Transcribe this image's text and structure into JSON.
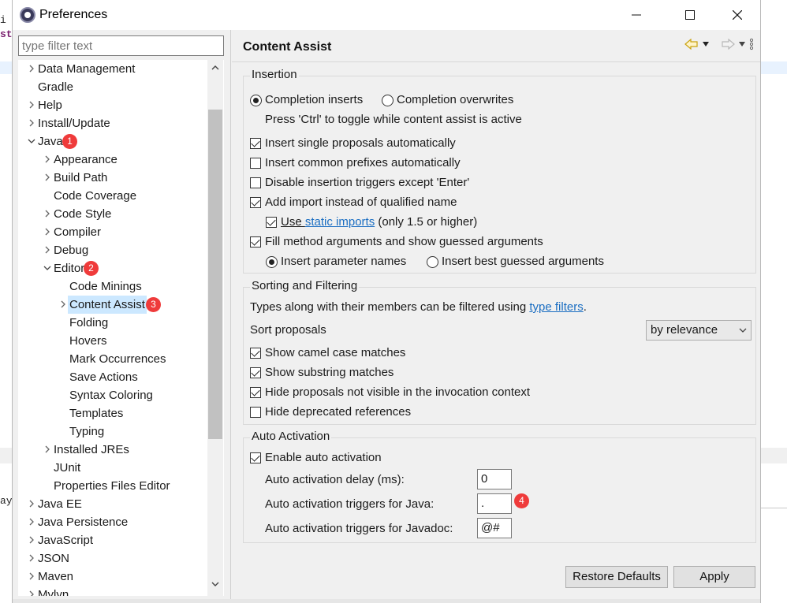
{
  "window": {
    "title": "Preferences"
  },
  "window_controls": {
    "minimize": "─",
    "maximize": "☐",
    "close": "✕"
  },
  "filter": {
    "placeholder": "type filter text"
  },
  "tree": {
    "items": [
      {
        "label": "Data Management",
        "expander": "collapsed"
      },
      {
        "label": "Gradle",
        "expander": "none"
      },
      {
        "label": "Help",
        "expander": "collapsed"
      },
      {
        "label": "Install/Update",
        "expander": "collapsed"
      },
      {
        "label": "Java",
        "expander": "expanded",
        "badge": "1"
      },
      {
        "label": "Appearance",
        "expander": "collapsed"
      },
      {
        "label": "Build Path",
        "expander": "collapsed"
      },
      {
        "label": "Code Coverage",
        "expander": "none"
      },
      {
        "label": "Code Style",
        "expander": "collapsed"
      },
      {
        "label": "Compiler",
        "expander": "collapsed"
      },
      {
        "label": "Debug",
        "expander": "collapsed"
      },
      {
        "label": "Editor",
        "expander": "expanded",
        "badge": "2"
      },
      {
        "label": "Code Minings",
        "expander": "none"
      },
      {
        "label": "Content Assist",
        "expander": "collapsed",
        "badge": "3",
        "selected": true
      },
      {
        "label": "Folding",
        "expander": "none"
      },
      {
        "label": "Hovers",
        "expander": "none"
      },
      {
        "label": "Mark Occurrences",
        "expander": "none"
      },
      {
        "label": "Save Actions",
        "expander": "none"
      },
      {
        "label": "Syntax Coloring",
        "expander": "none"
      },
      {
        "label": "Templates",
        "expander": "none"
      },
      {
        "label": "Typing",
        "expander": "none"
      },
      {
        "label": "Installed JREs",
        "expander": "collapsed"
      },
      {
        "label": "JUnit",
        "expander": "none"
      },
      {
        "label": "Properties Files Editor",
        "expander": "none"
      },
      {
        "label": "Java EE",
        "expander": "collapsed"
      },
      {
        "label": "Java Persistence",
        "expander": "collapsed"
      },
      {
        "label": "JavaScript",
        "expander": "collapsed"
      },
      {
        "label": "JSON",
        "expander": "collapsed"
      },
      {
        "label": "Maven",
        "expander": "collapsed"
      },
      {
        "label": "Mylyn",
        "expander": "collapsed"
      }
    ]
  },
  "page": {
    "title": "Content Assist"
  },
  "insertion": {
    "title": "Insertion",
    "radio_inserts": "Completion inserts",
    "radio_overwrites": "Completion overwrites",
    "toggle_hint": "Press 'Ctrl' to toggle while content assist is active",
    "single_proposals": "Insert single proposals automatically",
    "common_prefixes": "Insert common prefixes automatically",
    "disable_triggers": "Disable insertion triggers except 'Enter'",
    "add_import": "Add import instead of qualified name",
    "use_prefix": "Use ",
    "static_imports_link": "static imports",
    "static_imports_suffix": " (only 1.5 or higher)",
    "fill_method_args": "Fill method arguments and show guessed arguments",
    "param_names": "Insert parameter names",
    "best_guessed": "Insert best guessed arguments"
  },
  "sorting": {
    "title": "Sorting and Filtering",
    "types_text": "Types along with their members can be filtered using ",
    "type_filters_link": "type filters",
    "types_suffix": ".",
    "sort_label": "Sort proposals",
    "sort_value": "by relevance",
    "camel_case": "Show camel case matches",
    "substring": "Show substring matches",
    "hide_not_visible": "Hide proposals not visible in the invocation context",
    "hide_deprecated": "Hide deprecated references"
  },
  "auto_activation": {
    "title": "Auto Activation",
    "enable": "Enable auto activation",
    "delay_label": "Auto activation delay (ms):",
    "delay_value": "0",
    "java_label": "Auto activation triggers for Java:",
    "java_value": ".",
    "java_badge": "4",
    "javadoc_label": "Auto activation triggers for Javadoc:",
    "javadoc_value": "@#"
  },
  "buttons": {
    "restore_defaults": "Restore Defaults",
    "apply": "Apply"
  },
  "background": {
    "snippet1": "i -",
    "snippet2": "sta",
    "snippet3": "ay"
  },
  "colors": {
    "accent_link": "#1b6ec2",
    "badge": "#ef3b3b",
    "selection": "#cce8ff"
  }
}
